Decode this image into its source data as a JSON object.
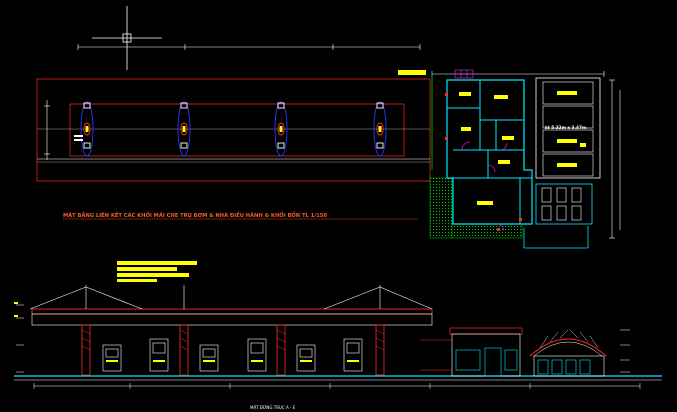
{
  "drawing": {
    "plan_title": "MẶT BẰNG LIÊN KẾT CÁC KHỐI MÁI CHE TRỤ BƠM & NHÀ ĐIỀU HÀNH & KHỐI BỒN  TL 1/150",
    "tank_label": "kt 5.32m x 3.47m",
    "bottom_caption": "MẶT ĐỨNG TRỤC A - E",
    "colors": {
      "background": "#000000",
      "line_white": "#ffffff",
      "line_red": "#ff2a2a",
      "line_cyan": "#00e5ff",
      "line_blue": "#1e3cff",
      "line_yellow": "#ffff00",
      "line_green": "#00c800",
      "line_magenta": "#ff2aff",
      "title_color": "#ff5a28"
    },
    "icons": [
      "crosshair-cursor-icon",
      "fuel-pump-icon",
      "truck-icon"
    ]
  }
}
